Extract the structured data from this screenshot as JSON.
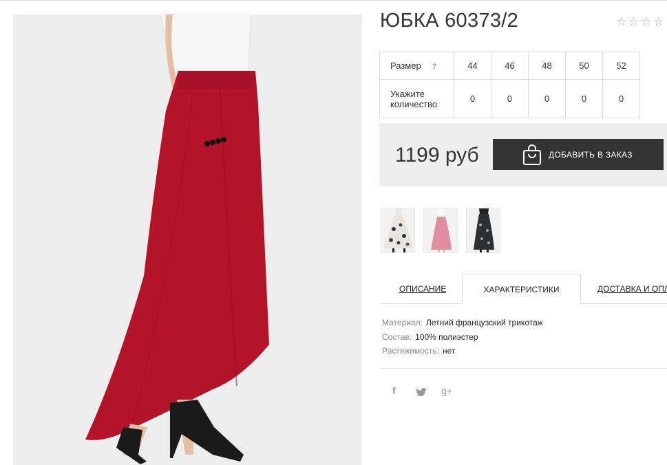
{
  "product": {
    "title": "ЮБКА 60373/2",
    "rating_stars": [
      "☆",
      "☆",
      "☆",
      "☆"
    ]
  },
  "size_table": {
    "size_label": "Размер",
    "hint": "?",
    "sizes": [
      "44",
      "46",
      "48",
      "50",
      "52"
    ],
    "qty_label_line1": "Укажите",
    "qty_label_line2": "количество",
    "quantities": [
      "0",
      "0",
      "0",
      "0",
      "0"
    ]
  },
  "purchase": {
    "price": "1199 руб",
    "add_button": "ДОБАВИТЬ В ЗАКАЗ"
  },
  "tabs": {
    "description": "ОПИСАНИЕ",
    "characteristics": "ХАРАКТЕРИСТИКИ",
    "delivery": "ДОСТАВКА И ОПЛ"
  },
  "specs": [
    {
      "key": "Материал:",
      "value": "Летний французский трикотаж"
    },
    {
      "key": "Состав:",
      "value": "100% полиэстер"
    },
    {
      "key": "Растяжимость:",
      "value": "нет"
    }
  ],
  "social": {
    "facebook": "f",
    "googleplus": "g+"
  },
  "colors": {
    "skirt_red": "#b4142a",
    "button_dark": "#333333",
    "price_bg": "#eeeeee"
  },
  "icons": [
    "star-icon",
    "bag-icon",
    "facebook-icon",
    "twitter-icon",
    "google-plus-icon"
  ]
}
